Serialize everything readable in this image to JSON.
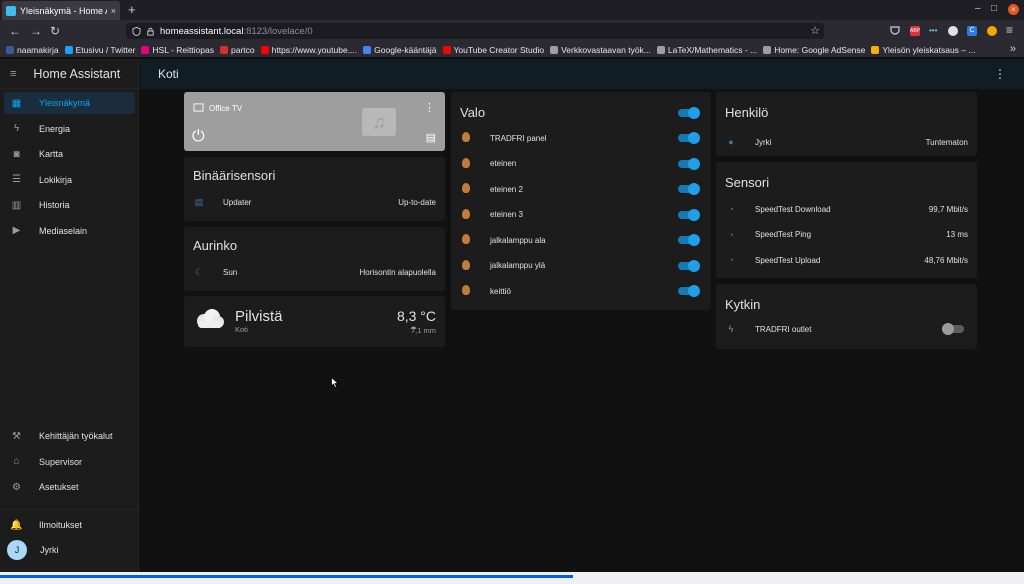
{
  "browser": {
    "tab_title": "Yleisnäkymä - Home Assi",
    "url_host": "homeassistant.local",
    "url_path": ":8123/lovelace/0",
    "bookmarks": [
      "naamakirja",
      "Etusivu / Twitter",
      "HSL - Reittiopas",
      "partco",
      "https://www.youtube....",
      "Google-kääntäjä",
      "YouTube Creator Studio",
      "Verkkovastaavan työk...",
      "LaTeX/Mathematics - ...",
      "Home: Google AdSense",
      "Yleisön yleiskatsaus – ..."
    ],
    "bookmark_colors": [
      "#3b5998",
      "#1da1f2",
      "#e6007e",
      "#d32f2f",
      "#ff0000",
      "#4285f4",
      "#ff0000",
      "#9e9e9e",
      "#9e9e9e",
      "#9e9e9e",
      "#f4b400"
    ],
    "close_glyph": "×",
    "new_tab_glyph": "+",
    "back_glyph": "←",
    "forward_glyph": "→",
    "reload_glyph": "↻",
    "star_glyph": "☆",
    "menu_glyph": "≡",
    "overflow_glyph": "»",
    "adp_label": "ABP",
    "dots_label": "•••",
    "ext_c_label": "C",
    "minimize_glyph": "–",
    "maximize_glyph": "□",
    "progress": 0.56
  },
  "sidebar": {
    "title": "Home Assistant",
    "items": [
      {
        "label": "Yleisnäkymä",
        "icon": "dashboard-icon",
        "glyph": "▦"
      },
      {
        "label": "Energia",
        "icon": "lightning-icon",
        "glyph": "ϟ"
      },
      {
        "label": "Kartta",
        "icon": "map-icon",
        "glyph": "◙"
      },
      {
        "label": "Lokikirja",
        "icon": "list-icon",
        "glyph": "☰"
      },
      {
        "label": "Historia",
        "icon": "chart-icon",
        "glyph": "▥"
      },
      {
        "label": "Mediaselain",
        "icon": "media-icon",
        "glyph": "▶"
      }
    ],
    "bottom_items": [
      {
        "label": "Kehittäjän työkalut",
        "icon": "hammer-icon",
        "glyph": "⚒"
      },
      {
        "label": "Supervisor",
        "icon": "home-icon",
        "glyph": "⌂"
      },
      {
        "label": "Asetukset",
        "icon": "gear-icon",
        "glyph": "⚙"
      }
    ],
    "notifications": "Ilmoitukset",
    "notifications_glyph": "🔔",
    "user": "Jyrki",
    "user_initial": "J",
    "menu_glyph": "≡"
  },
  "topbar": {
    "title": "Koti",
    "menu_glyph": "⋮"
  },
  "media": {
    "name": "Office TV",
    "menu_glyph": "⋮",
    "power_glyph": "⏻",
    "placeholder_glyph": "♫",
    "browse_glyph": "▤",
    "cast_glyph": "▭"
  },
  "binary": {
    "title": "Binäärisensori",
    "name": "Updater",
    "state": "Up-to-date",
    "glyph": "▤"
  },
  "sun": {
    "title": "Aurinko",
    "name": "Sun",
    "state": "Horisontin alapuolella",
    "glyph": "☾"
  },
  "weather": {
    "condition": "Pilvistä",
    "location": "Koti",
    "temperature": "8,3 °C",
    "precipitation": "7,1 mm",
    "rain_glyph": "☂"
  },
  "lights": {
    "title": "Valo",
    "items": [
      "TRADFRI panel",
      "eteinen",
      "eteinen 2",
      "eteinen 3",
      "jalkalamppu ala",
      "jalkalamppu ylä",
      "keittiö"
    ]
  },
  "person": {
    "title": "Henkilö",
    "name": "Jyrki",
    "state": "Tuntematon",
    "glyph": "●"
  },
  "sensors": {
    "title": "Sensori",
    "glyph": "◔",
    "items": [
      {
        "name": "SpeedTest Download",
        "value": "99,7 Mbit/s"
      },
      {
        "name": "SpeedTest Ping",
        "value": "13 ms"
      },
      {
        "name": "SpeedTest Upload",
        "value": "48,76 Mbit/s"
      }
    ]
  },
  "switch": {
    "title": "Kytkin",
    "name": "TRADFRI outlet",
    "glyph": "ϟ"
  }
}
